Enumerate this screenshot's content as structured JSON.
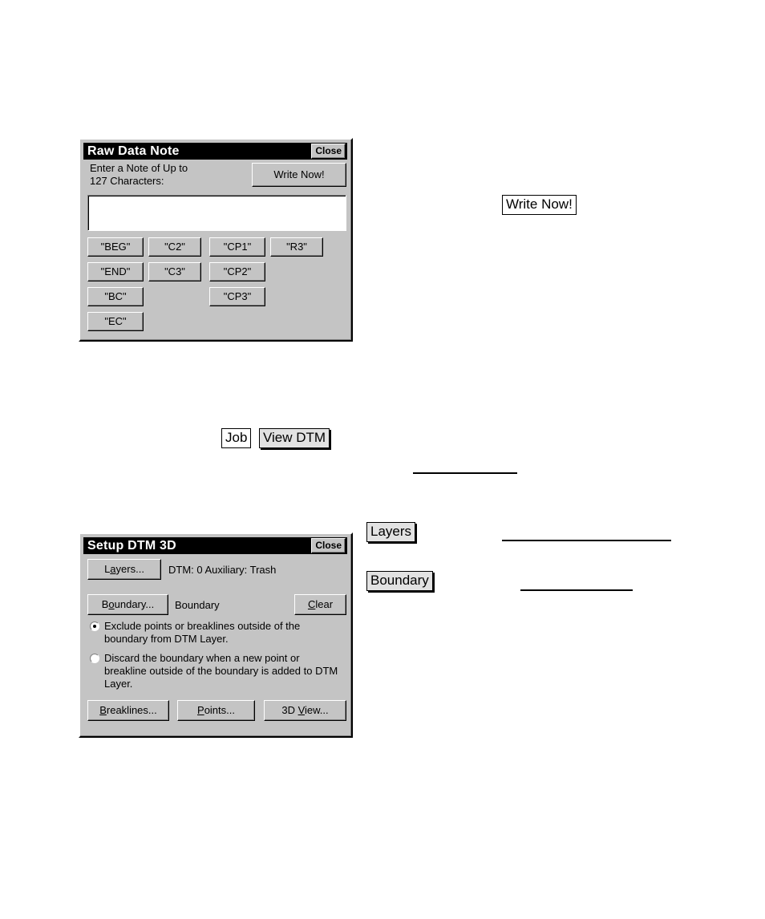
{
  "page": {
    "background": "#ffffff",
    "dialog_face": "#c4c4c4"
  },
  "raw_data_note_dialog": {
    "title": "Raw Data Note",
    "close_label": "Close",
    "prompt": "Enter a Note of Up to\n127 Characters:",
    "write_now_label": "Write Now!",
    "note_input": {
      "value": "",
      "placeholder": ""
    },
    "code_buttons": [
      {
        "label": "\"BEG\"",
        "col": 0,
        "row": 0
      },
      {
        "label": "\"C2\"",
        "col": 1,
        "row": 0
      },
      {
        "label": "\"CP1\"",
        "col": 2,
        "row": 0
      },
      {
        "label": "\"R3\"",
        "col": 3,
        "row": 0
      },
      {
        "label": "\"END\"",
        "col": 0,
        "row": 1
      },
      {
        "label": "\"C3\"",
        "col": 1,
        "row": 1
      },
      {
        "label": "\"CP2\"",
        "col": 2,
        "row": 1
      },
      {
        "label": "\"BC\"",
        "col": 0,
        "row": 2
      },
      {
        "label": "\"CP3\"",
        "col": 2,
        "row": 2
      },
      {
        "label": "\"EC\"",
        "col": 0,
        "row": 3
      }
    ]
  },
  "setup_dtm_dialog": {
    "title": "Setup DTM 3D",
    "close_label": "Close",
    "layers_button": {
      "pre": "L",
      "mnemonic": "a",
      "post": "yers..."
    },
    "layers_status": "DTM: 0 Auxiliary: Trash",
    "boundary_button": {
      "pre": "B",
      "mnemonic": "o",
      "post": "undary..."
    },
    "boundary_status": "Boundary",
    "clear_button": {
      "pre": "",
      "mnemonic": "C",
      "post": "lear"
    },
    "radio_options": [
      {
        "text": "Exclude points or breaklines outside of the boundary from DTM Layer.",
        "selected": true
      },
      {
        "text": "Discard the boundary when a new point or breakline outside of the boundary is added to DTM Layer.",
        "selected": false
      }
    ],
    "breaklines_button": {
      "pre": "",
      "mnemonic": "B",
      "post": "reaklines..."
    },
    "points_button": {
      "pre": "",
      "mnemonic": "P",
      "post": "oints..."
    },
    "view_3d_button": {
      "pre": "3D ",
      "mnemonic": "V",
      "post": "iew..."
    }
  },
  "reference_labels": {
    "write_now": "Write Now!",
    "job": "Job",
    "view_dtm": "View DTM",
    "layers": "Layers",
    "boundary": "Boundary"
  }
}
